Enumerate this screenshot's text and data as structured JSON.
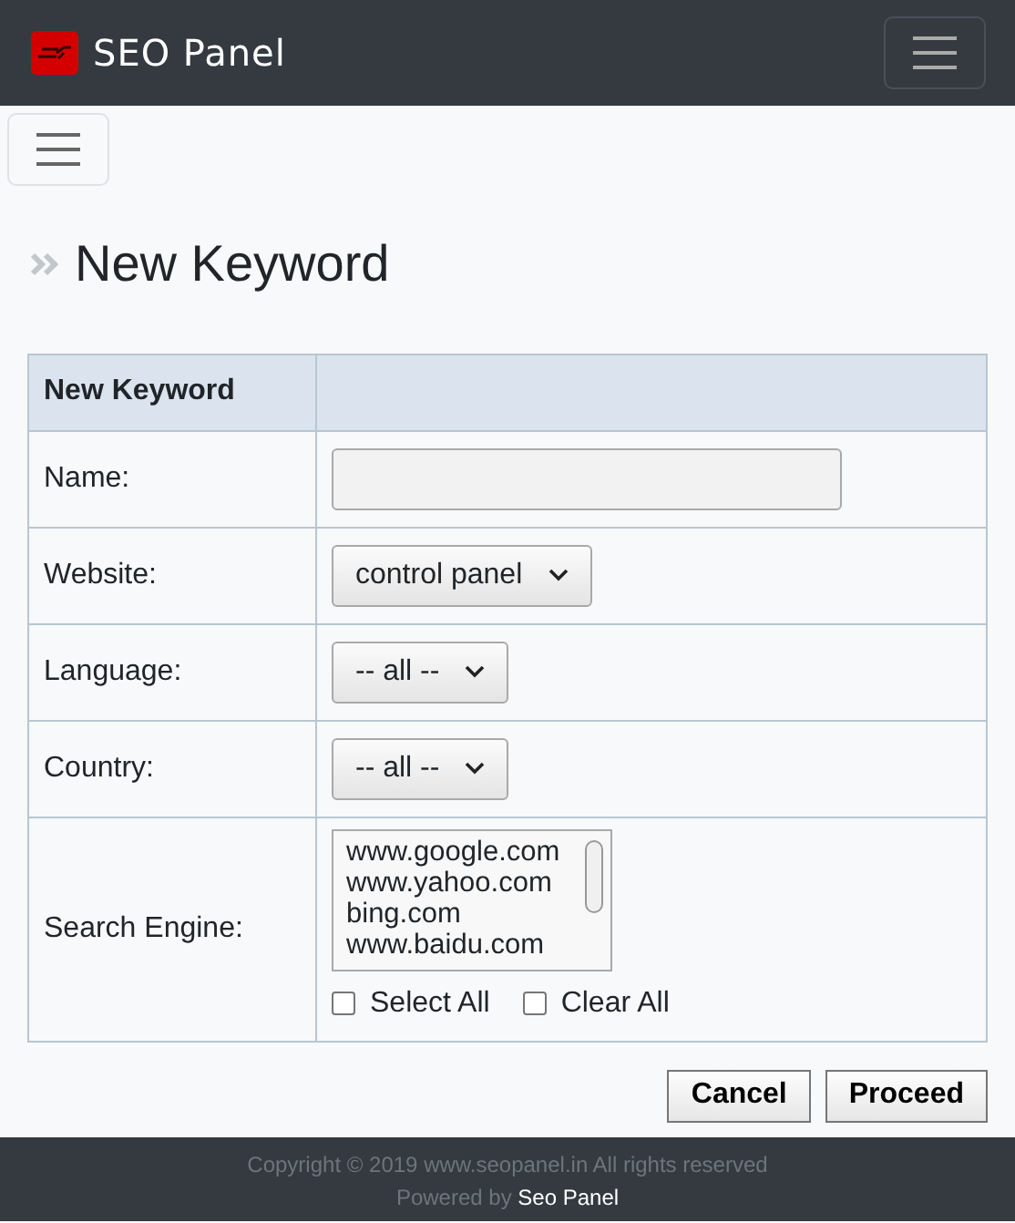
{
  "brand": "SEO Panel",
  "page_title": "New Keyword",
  "form": {
    "header": "New Keyword",
    "rows": [
      {
        "kind": "text",
        "label": "Name:",
        "value": ""
      },
      {
        "kind": "select",
        "label": "Website:",
        "value": "control panel"
      },
      {
        "kind": "select",
        "label": "Language:",
        "value": "-- all --"
      },
      {
        "kind": "select",
        "label": "Country:",
        "value": "-- all --"
      },
      {
        "kind": "listbox",
        "label": "Search Engine:",
        "options": [
          "www.google.com",
          "www.yahoo.com",
          "bing.com",
          "www.baidu.com"
        ],
        "checks": [
          {
            "label": "Select All",
            "checked": false
          },
          {
            "label": "Clear All",
            "checked": false
          }
        ]
      }
    ]
  },
  "buttons": [
    "Cancel",
    "Proceed"
  ],
  "footer": {
    "copyright": "Copyright © 2019 www.seopanel.in All rights reserved",
    "powered": "Powered by",
    "link": "Seo Panel"
  }
}
